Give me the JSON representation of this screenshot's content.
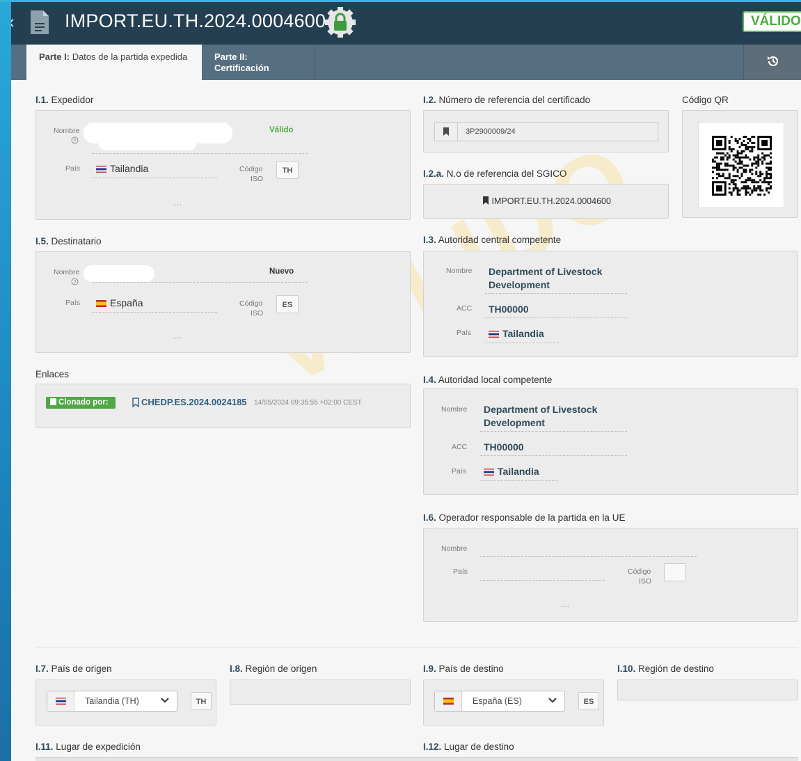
{
  "header": {
    "title": "IMPORT.EU.TH.2024.0004600",
    "status": "VÁLIDO",
    "icons": {
      "back": "chevron-left-icon",
      "doc": "document-icon",
      "lock": "lock-badge-icon",
      "history": "history-icon"
    },
    "colors": {
      "header_bg": "#253f52",
      "status_green": "#4ea944"
    }
  },
  "tabs": [
    {
      "prefix": "Parte I:",
      "label": " Datos de la partida expedida",
      "active": true
    },
    {
      "prefix": "Parte II:",
      "label": " Certificación",
      "active": false
    }
  ],
  "watermark": "VÁLIDO",
  "common": {
    "nombre": "Nombre",
    "pais": "País",
    "codigo": "Código",
    "iso": "ISO",
    "acc": "ACC",
    "ellipsis": "..."
  },
  "expedidor": {
    "code": "I.1.",
    "label": "Expedidor",
    "badge": "Válido",
    "country": "Tailandia",
    "iso": "TH"
  },
  "destinatario": {
    "code": "I.5.",
    "label": "Destinatario",
    "badge": "Nuevo",
    "country": "España",
    "iso": "ES"
  },
  "enlaces": {
    "label": "Enlaces",
    "clone_badge": "Clonado por:",
    "link": "CHEDP.ES.2024.0024185",
    "timestamp": "14/05/2024 09:35:55 +02:00 CEST"
  },
  "ref_cert": {
    "code": "I.2.",
    "label": "Número de referencia del certificado",
    "value": "3P2900009/24"
  },
  "qr": {
    "label": "Código QR"
  },
  "ref_sgico": {
    "code": "I.2.a.",
    "label": "N.o de referencia del SGICO",
    "value": "IMPORT.EU.TH.2024.0004600"
  },
  "aut_central": {
    "code": "I.3.",
    "label": "Autoridad central competente",
    "name_line1": "Department of Livestock",
    "name_line2": "Development",
    "acc": "TH00000",
    "country": "Tailandia"
  },
  "aut_local": {
    "code": "I.4.",
    "label": "Autoridad local competente",
    "name_line1": "Department of Livestock",
    "name_line2": "Development",
    "acc": "TH00000",
    "country": "Tailandia"
  },
  "operador": {
    "code": "I.6.",
    "label": "Operador responsable de la partida en la UE"
  },
  "pais_origen": {
    "code": "I.7.",
    "label": "País de origen",
    "selected": "Tailandia (TH)",
    "iso": "TH"
  },
  "region_origen": {
    "code": "I.8.",
    "label": "Región de origen"
  },
  "pais_destino": {
    "code": "I.9.",
    "label": "País de destino",
    "selected": "España (ES)",
    "iso": "ES"
  },
  "region_destino": {
    "code": "I.10.",
    "label": "Región de destino"
  },
  "lugar_exp": {
    "code": "I.11.",
    "label": "Lugar de expedición"
  },
  "lugar_dest": {
    "code": "I.12.",
    "label": "Lugar de destino"
  }
}
